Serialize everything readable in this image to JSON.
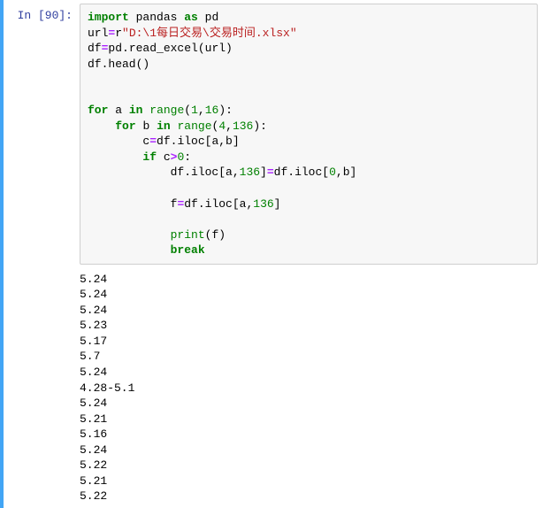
{
  "prompt": "In [90]:",
  "code": {
    "kw_import": "import",
    "mod_pandas": "pandas",
    "kw_as": "as",
    "alias_pd": "pd",
    "var_url": "url",
    "op_eq": "=",
    "str_prefix_r": "r",
    "str_path": "\"D:\\1每日交易\\交易时间.xlsx\"",
    "var_df": "df",
    "pd_read_excel": "pd.read_excel(url)",
    "df_head": "df.head()",
    "kw_for": "for",
    "var_a": "a",
    "kw_in": "in",
    "fn_range": "range",
    "lp": "(",
    "rp": ")",
    "comma": ",",
    "num_1": "1",
    "num_16": "16",
    "colon": ":",
    "var_b": "b",
    "num_4": "4",
    "num_136": "136",
    "var_c": "c",
    "df_iloc_ab": "df.iloc[a,b]",
    "kw_if": "if",
    "op_gt": ">",
    "num_0": "0",
    "df_iloc_a136": "df.iloc[a,",
    "df_iloc_a136_b": "]",
    "df_iloc_0b": "df.iloc[",
    "df_iloc_0b_mid": ",b]",
    "var_f": "f",
    "fn_print": "print",
    "print_arg": "(f)",
    "kw_break": "break"
  },
  "output_lines": [
    "5.24",
    "5.24",
    "5.24",
    "5.23",
    "5.17",
    "5.7",
    "5.24",
    "4.28-5.1",
    "5.24",
    "5.21",
    "5.16",
    "5.24",
    "5.22",
    "5.21",
    "5.22"
  ]
}
